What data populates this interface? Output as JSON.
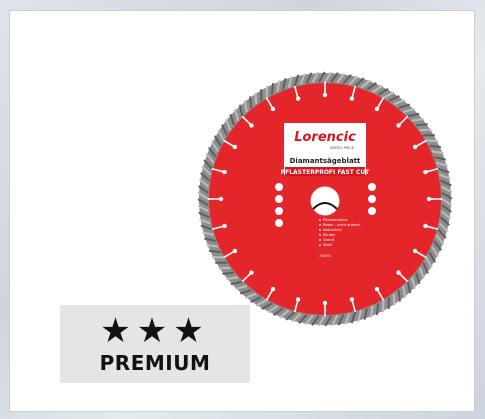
{
  "product": {
    "brand": "Lorencic",
    "brand_sub": "SIMPLE PRICE",
    "title": "Diamantsägeblatt",
    "subtitle": "PFLASTERPROFI FAST CUT",
    "features": [
      "Pflastersteine",
      "Beton - nicht armiert",
      "Naturstein",
      "Klinker",
      "Granit",
      "Stahl"
    ],
    "article_no": "20470"
  },
  "badge": {
    "stars": "★★★",
    "label": "PREMIUM"
  },
  "colors": {
    "blade_red": "#e4262a",
    "blade_dark_red": "#b3151a",
    "segment_gray": "#8e8e8e",
    "badge_bg": "#e5e5e5"
  }
}
